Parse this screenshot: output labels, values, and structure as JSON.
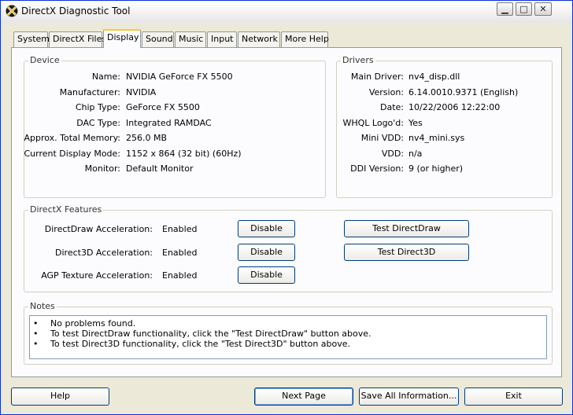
{
  "window": {
    "title": "DirectX Diagnostic Tool",
    "minimize": "▁",
    "maximize": "□",
    "close": "✕"
  },
  "tabs": [
    "System",
    "DirectX Files",
    "Display",
    "Sound",
    "Music",
    "Input",
    "Network",
    "More Help"
  ],
  "active_tab": "Display",
  "device": {
    "title": "Device",
    "rows": [
      {
        "label": "Name:",
        "value": "NVIDIA GeForce FX 5500"
      },
      {
        "label": "Manufacturer:",
        "value": "NVIDIA"
      },
      {
        "label": "Chip Type:",
        "value": "GeForce FX 5500"
      },
      {
        "label": "DAC Type:",
        "value": "Integrated RAMDAC"
      },
      {
        "label": "Approx. Total Memory:",
        "value": "256.0 MB"
      },
      {
        "label": "Current Display Mode:",
        "value": "1152 x 864 (32 bit) (60Hz)"
      },
      {
        "label": "Monitor:",
        "value": "Default Monitor"
      }
    ]
  },
  "drivers": {
    "title": "Drivers",
    "rows": [
      {
        "label": "Main Driver:",
        "value": "nv4_disp.dll"
      },
      {
        "label": "Version:",
        "value": "6.14.0010.9371 (English)"
      },
      {
        "label": "Date:",
        "value": "10/22/2006 12:22:00"
      },
      {
        "label": "WHQL Logo'd:",
        "value": "Yes"
      },
      {
        "label": "Mini VDD:",
        "value": "nv4_mini.sys"
      },
      {
        "label": "VDD:",
        "value": "n/a"
      },
      {
        "label": "DDI Version:",
        "value": "9 (or higher)"
      }
    ]
  },
  "features": {
    "title": "DirectX Features",
    "rows": [
      {
        "label": "DirectDraw Acceleration:",
        "status": "Enabled",
        "button": "Disable",
        "test": "Test DirectDraw"
      },
      {
        "label": "Direct3D Acceleration:",
        "status": "Enabled",
        "button": "Disable",
        "test": "Test Direct3D"
      },
      {
        "label": "AGP Texture Acceleration:",
        "status": "Enabled",
        "button": "Disable"
      }
    ]
  },
  "notes": {
    "title": "Notes",
    "bullet": "•",
    "lines": [
      "No problems found.",
      "To test DirectDraw functionality, click the \"Test DirectDraw\" button above.",
      "To test Direct3D functionality, click the \"Test Direct3D\" button above."
    ]
  },
  "footer": {
    "help": "Help",
    "next": "Next Page",
    "save": "Save All Information...",
    "exit": "Exit"
  }
}
